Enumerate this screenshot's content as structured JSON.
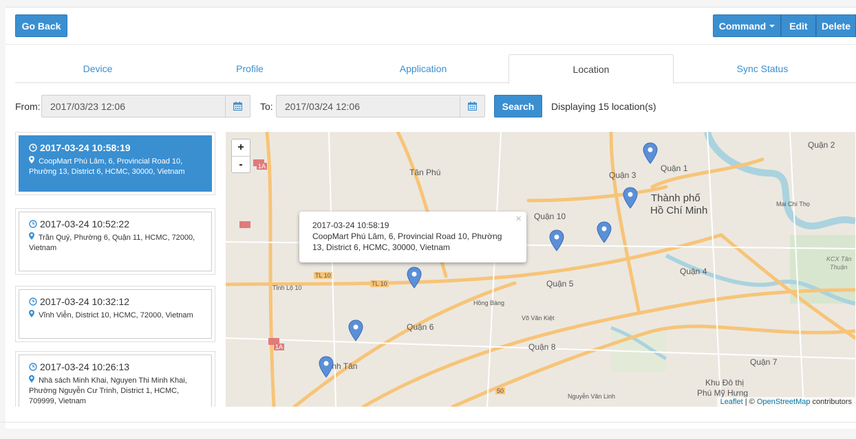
{
  "header": {
    "go_back_label": "Go Back",
    "command_label": "Command",
    "edit_label": "Edit",
    "delete_label": "Delete"
  },
  "tabs": [
    {
      "label": "Device",
      "active": false
    },
    {
      "label": "Profile",
      "active": false
    },
    {
      "label": "Application",
      "active": false
    },
    {
      "label": "Location",
      "active": true
    },
    {
      "label": "Sync Status",
      "active": false
    }
  ],
  "filter": {
    "from_label": "From:",
    "from_value": "2017/03/23 12:06",
    "to_label": "To:",
    "to_value": "2017/03/24 12:06",
    "search_label": "Search",
    "result_text": "Displaying 15 location(s)"
  },
  "locations": [
    {
      "time": "2017-03-24 10:58:19",
      "address": "CoopMart Phú Lâm, 6, Provincial Road 10, Phường 13, District 6, HCMC, 30000, Vietnam",
      "active": true
    },
    {
      "time": "2017-03-24 10:52:22",
      "address": "Trần Quý, Phường 6, Quận 11, HCMC, 72000, Vietnam",
      "active": false
    },
    {
      "time": "2017-03-24 10:32:12",
      "address": "Vĩnh Viễn, District 10, HCMC, 72000, Vietnam",
      "active": false
    },
    {
      "time": "2017-03-24 10:26:13",
      "address": "Nhà sách Minh Khai, Nguyen Thi Minh Khai, Phường Nguyễn Cư Trinh, District 1, HCMC, 709999, Vietnam",
      "active": false
    }
  ],
  "map": {
    "zoom_in": "+",
    "zoom_out": "-",
    "popup": {
      "time": "2017-03-24 10:58:19",
      "address": "CoopMart Phú Lâm, 6, Provincial Road 10, Phường 13, District 6, HCMC, 30000, Vietnam",
      "close": "×"
    },
    "labels": {
      "tan_phu": "Tân Phú",
      "quan_1": "Quận 1",
      "quan_2": "Quận 2",
      "quan_3": "Quận 3",
      "quan_4": "Quận 4",
      "quan_5": "Quận 5",
      "quan_6": "Quận 6",
      "quan_7": "Quận 7",
      "quan_8": "Quận 8",
      "quan_10": "Quận 10",
      "binh_tan": "Bình Tân",
      "thanh_pho": "Thành phố",
      "ho_chi_minh": "Hồ Chí Minh",
      "khu_do_thi": "Khu Đô thị",
      "phu_my_hung": "Phú Mỹ Hưng",
      "kcx": "KCX Tân",
      "thuan": "Thuận",
      "tl10": "TL 10",
      "tinh_lo_10": "Tỉnh Lộ 10",
      "hong_bang": "Hồng Bàng",
      "vo_van_kiet": "Võ Văn Kiệt",
      "nguyen_van_linh": "Nguyễn Văn Linh",
      "mai_chi_tho": "Mai Chí Thọ",
      "road_1a": "1A",
      "road_50": "50"
    },
    "attribution_leaflet": "Leaflet",
    "attribution_osm": "OpenStreetMap",
    "attribution_suffix": " contributors",
    "colors": {
      "water": "#aad3df",
      "marker": "#5b8fd8",
      "road": "#f7c478"
    }
  }
}
